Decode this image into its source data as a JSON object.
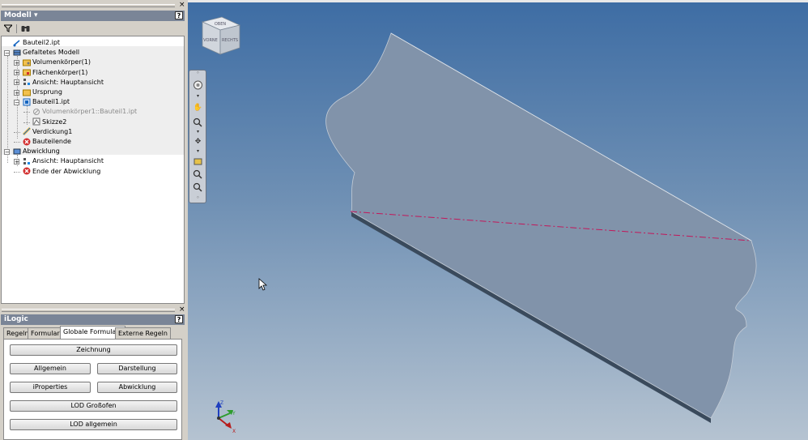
{
  "model_panel": {
    "title": "Modell ▾",
    "help": "?",
    "close": "×",
    "tree": [
      {
        "label": "Bauteil2.ipt",
        "icon": "part-file-icon",
        "level": 0,
        "expander": ""
      },
      {
        "label": "Gefaltetes Modell",
        "icon": "folded-model-icon",
        "level": 0,
        "expander": "−"
      },
      {
        "label": "Volumenkörper(1)",
        "icon": "solid-bodies-folder-icon",
        "level": 1,
        "expander": "+"
      },
      {
        "label": "Flächenkörper(1)",
        "icon": "surface-bodies-folder-icon",
        "level": 1,
        "expander": "+"
      },
      {
        "label": "Ansicht: Hauptansicht",
        "icon": "view-rep-icon",
        "level": 1,
        "expander": "+"
      },
      {
        "label": "Ursprung",
        "icon": "origin-folder-icon",
        "level": 1,
        "expander": "+"
      },
      {
        "label": "Bauteil1.ipt",
        "icon": "derived-part-icon",
        "level": 1,
        "expander": "−"
      },
      {
        "label": "Volumenkörper1::Bauteil1.ipt",
        "icon": "derived-body-icon",
        "level": 2,
        "expander": "",
        "greyed": true
      },
      {
        "label": "Skizze2",
        "icon": "sketch-icon",
        "level": 2,
        "expander": ""
      },
      {
        "label": "Verdickung1",
        "icon": "thicken-icon",
        "level": 1,
        "expander": ""
      },
      {
        "label": "Bauteilende",
        "icon": "end-of-part-icon",
        "level": 1,
        "expander": ""
      },
      {
        "label": "Abwicklung",
        "icon": "flat-pattern-icon",
        "level": 0,
        "expander": "−"
      },
      {
        "label": "Ansicht: Hauptansicht",
        "icon": "view-rep-icon",
        "level": 1,
        "expander": "+"
      },
      {
        "label": "Ende der Abwicklung",
        "icon": "end-of-flat-icon",
        "level": 1,
        "expander": ""
      }
    ]
  },
  "ilogic_panel": {
    "title": "iLogic",
    "help": "?",
    "close": "×",
    "tabs": [
      "Regeln",
      "Formulare",
      "Globale Formulare",
      "Externe Regeln"
    ],
    "active_tab": "Globale Formulare",
    "buttons": {
      "zeichnung": "Zeichnung",
      "allgemein": "Allgemein",
      "darstellung": "Darstellung",
      "iproperties": "iProperties",
      "abwicklung": "Abwicklung",
      "lod_grossofen": "LOD Großofen",
      "lod_allgemein": "LOD allgemein"
    }
  },
  "viewcube": {
    "top_label": "OBEN",
    "front_label": "VORNE",
    "right_label": "RECHTS"
  },
  "colors": {
    "viewport_top": "#3e6da4",
    "viewport_bottom": "#b5c3d1",
    "sheet_face": "#8193aa",
    "bend_line": "#c2185b",
    "panel_header": "#7a8597"
  }
}
